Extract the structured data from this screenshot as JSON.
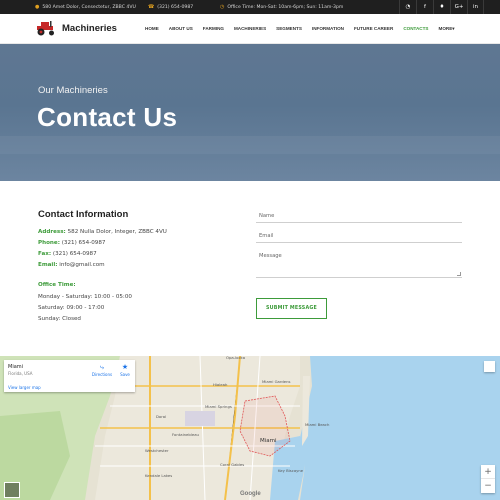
{
  "topbar": {
    "address": "580 Amet Dolor, Consectetur, ZBBC 4VU",
    "phone": "(321) 654-0987",
    "office_time": "Office Time: Mon-Sat: 10am-6pm; Sun: 11am-3pm",
    "socials": [
      "rss-icon",
      "facebook-icon",
      "twitter-icon",
      "google-plus-icon",
      "linkedin-icon"
    ],
    "social_glyphs": [
      "◔",
      "f",
      "♦",
      "G+",
      "in"
    ]
  },
  "nav": {
    "brand": "Machineries",
    "items": [
      {
        "label": "HOME"
      },
      {
        "label": "ABOUT US"
      },
      {
        "label": "FARMING"
      },
      {
        "label": "MACHINERIES"
      },
      {
        "label": "SEGMENTS"
      },
      {
        "label": "INFORMATION"
      },
      {
        "label": "FUTURE CAREER"
      },
      {
        "label": "CONTACTS"
      },
      {
        "label": "MORE▾"
      }
    ],
    "active": "CONTACTS"
  },
  "hero": {
    "subtitle": "Our Machineries",
    "title": "Contact Us"
  },
  "contact": {
    "heading": "Contact Information",
    "address_label": "Address:",
    "address": " 582 Nulla Dolor, Integer, ZBBC 4VU",
    "phone_label": "Phone:",
    "phone": " (321) 654-0987",
    "fax_label": "Fax:",
    "fax": " (321) 654-0987",
    "email_label": "Email:",
    "email": " info@gmail.com",
    "office_label": "Office Time:",
    "hours": [
      "Monday - Saturday: 10:00 - 05:00",
      "Saturday: 09:00 - 17:00",
      "Sunday: Closed"
    ]
  },
  "form": {
    "name_placeholder": "Name",
    "email_placeholder": "Email",
    "message_placeholder": "Message",
    "submit_label": "SUBMIT MESSAGE"
  },
  "map": {
    "city": "Miami",
    "state": "Florida, USA",
    "larger_map": "View larger map",
    "directions": "Directions",
    "save": "Save",
    "zoom_in": "+",
    "zoom_out": "−",
    "google": "Google",
    "labels": [
      "Hialeah",
      "Miami Springs",
      "Doral",
      "Miami",
      "Miami Beach",
      "Fontainebleau",
      "Westchester",
      "Kendale Lakes",
      "Coral Gables",
      "Key Biscayne",
      "Opa-locka",
      "Miami Gardens"
    ]
  },
  "colors": {
    "accent": "#3d9b3a",
    "topbar": "#1f1f1f",
    "hero": "#5f7792"
  }
}
